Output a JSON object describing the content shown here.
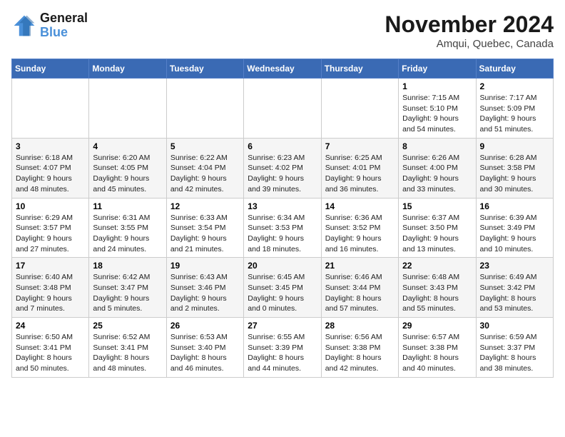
{
  "header": {
    "logo_line1": "General",
    "logo_line2": "Blue",
    "month": "November 2024",
    "location": "Amqui, Quebec, Canada"
  },
  "weekdays": [
    "Sunday",
    "Monday",
    "Tuesday",
    "Wednesday",
    "Thursday",
    "Friday",
    "Saturday"
  ],
  "weeks": [
    [
      {
        "day": "",
        "info": ""
      },
      {
        "day": "",
        "info": ""
      },
      {
        "day": "",
        "info": ""
      },
      {
        "day": "",
        "info": ""
      },
      {
        "day": "",
        "info": ""
      },
      {
        "day": "1",
        "info": "Sunrise: 7:15 AM\nSunset: 5:10 PM\nDaylight: 9 hours\nand 54 minutes."
      },
      {
        "day": "2",
        "info": "Sunrise: 7:17 AM\nSunset: 5:09 PM\nDaylight: 9 hours\nand 51 minutes."
      }
    ],
    [
      {
        "day": "3",
        "info": "Sunrise: 6:18 AM\nSunset: 4:07 PM\nDaylight: 9 hours\nand 48 minutes."
      },
      {
        "day": "4",
        "info": "Sunrise: 6:20 AM\nSunset: 4:05 PM\nDaylight: 9 hours\nand 45 minutes."
      },
      {
        "day": "5",
        "info": "Sunrise: 6:22 AM\nSunset: 4:04 PM\nDaylight: 9 hours\nand 42 minutes."
      },
      {
        "day": "6",
        "info": "Sunrise: 6:23 AM\nSunset: 4:02 PM\nDaylight: 9 hours\nand 39 minutes."
      },
      {
        "day": "7",
        "info": "Sunrise: 6:25 AM\nSunset: 4:01 PM\nDaylight: 9 hours\nand 36 minutes."
      },
      {
        "day": "8",
        "info": "Sunrise: 6:26 AM\nSunset: 4:00 PM\nDaylight: 9 hours\nand 33 minutes."
      },
      {
        "day": "9",
        "info": "Sunrise: 6:28 AM\nSunset: 3:58 PM\nDaylight: 9 hours\nand 30 minutes."
      }
    ],
    [
      {
        "day": "10",
        "info": "Sunrise: 6:29 AM\nSunset: 3:57 PM\nDaylight: 9 hours\nand 27 minutes."
      },
      {
        "day": "11",
        "info": "Sunrise: 6:31 AM\nSunset: 3:55 PM\nDaylight: 9 hours\nand 24 minutes."
      },
      {
        "day": "12",
        "info": "Sunrise: 6:33 AM\nSunset: 3:54 PM\nDaylight: 9 hours\nand 21 minutes."
      },
      {
        "day": "13",
        "info": "Sunrise: 6:34 AM\nSunset: 3:53 PM\nDaylight: 9 hours\nand 18 minutes."
      },
      {
        "day": "14",
        "info": "Sunrise: 6:36 AM\nSunset: 3:52 PM\nDaylight: 9 hours\nand 16 minutes."
      },
      {
        "day": "15",
        "info": "Sunrise: 6:37 AM\nSunset: 3:50 PM\nDaylight: 9 hours\nand 13 minutes."
      },
      {
        "day": "16",
        "info": "Sunrise: 6:39 AM\nSunset: 3:49 PM\nDaylight: 9 hours\nand 10 minutes."
      }
    ],
    [
      {
        "day": "17",
        "info": "Sunrise: 6:40 AM\nSunset: 3:48 PM\nDaylight: 9 hours\nand 7 minutes."
      },
      {
        "day": "18",
        "info": "Sunrise: 6:42 AM\nSunset: 3:47 PM\nDaylight: 9 hours\nand 5 minutes."
      },
      {
        "day": "19",
        "info": "Sunrise: 6:43 AM\nSunset: 3:46 PM\nDaylight: 9 hours\nand 2 minutes."
      },
      {
        "day": "20",
        "info": "Sunrise: 6:45 AM\nSunset: 3:45 PM\nDaylight: 9 hours\nand 0 minutes."
      },
      {
        "day": "21",
        "info": "Sunrise: 6:46 AM\nSunset: 3:44 PM\nDaylight: 8 hours\nand 57 minutes."
      },
      {
        "day": "22",
        "info": "Sunrise: 6:48 AM\nSunset: 3:43 PM\nDaylight: 8 hours\nand 55 minutes."
      },
      {
        "day": "23",
        "info": "Sunrise: 6:49 AM\nSunset: 3:42 PM\nDaylight: 8 hours\nand 53 minutes."
      }
    ],
    [
      {
        "day": "24",
        "info": "Sunrise: 6:50 AM\nSunset: 3:41 PM\nDaylight: 8 hours\nand 50 minutes."
      },
      {
        "day": "25",
        "info": "Sunrise: 6:52 AM\nSunset: 3:41 PM\nDaylight: 8 hours\nand 48 minutes."
      },
      {
        "day": "26",
        "info": "Sunrise: 6:53 AM\nSunset: 3:40 PM\nDaylight: 8 hours\nand 46 minutes."
      },
      {
        "day": "27",
        "info": "Sunrise: 6:55 AM\nSunset: 3:39 PM\nDaylight: 8 hours\nand 44 minutes."
      },
      {
        "day": "28",
        "info": "Sunrise: 6:56 AM\nSunset: 3:38 PM\nDaylight: 8 hours\nand 42 minutes."
      },
      {
        "day": "29",
        "info": "Sunrise: 6:57 AM\nSunset: 3:38 PM\nDaylight: 8 hours\nand 40 minutes."
      },
      {
        "day": "30",
        "info": "Sunrise: 6:59 AM\nSunset: 3:37 PM\nDaylight: 8 hours\nand 38 minutes."
      }
    ]
  ]
}
